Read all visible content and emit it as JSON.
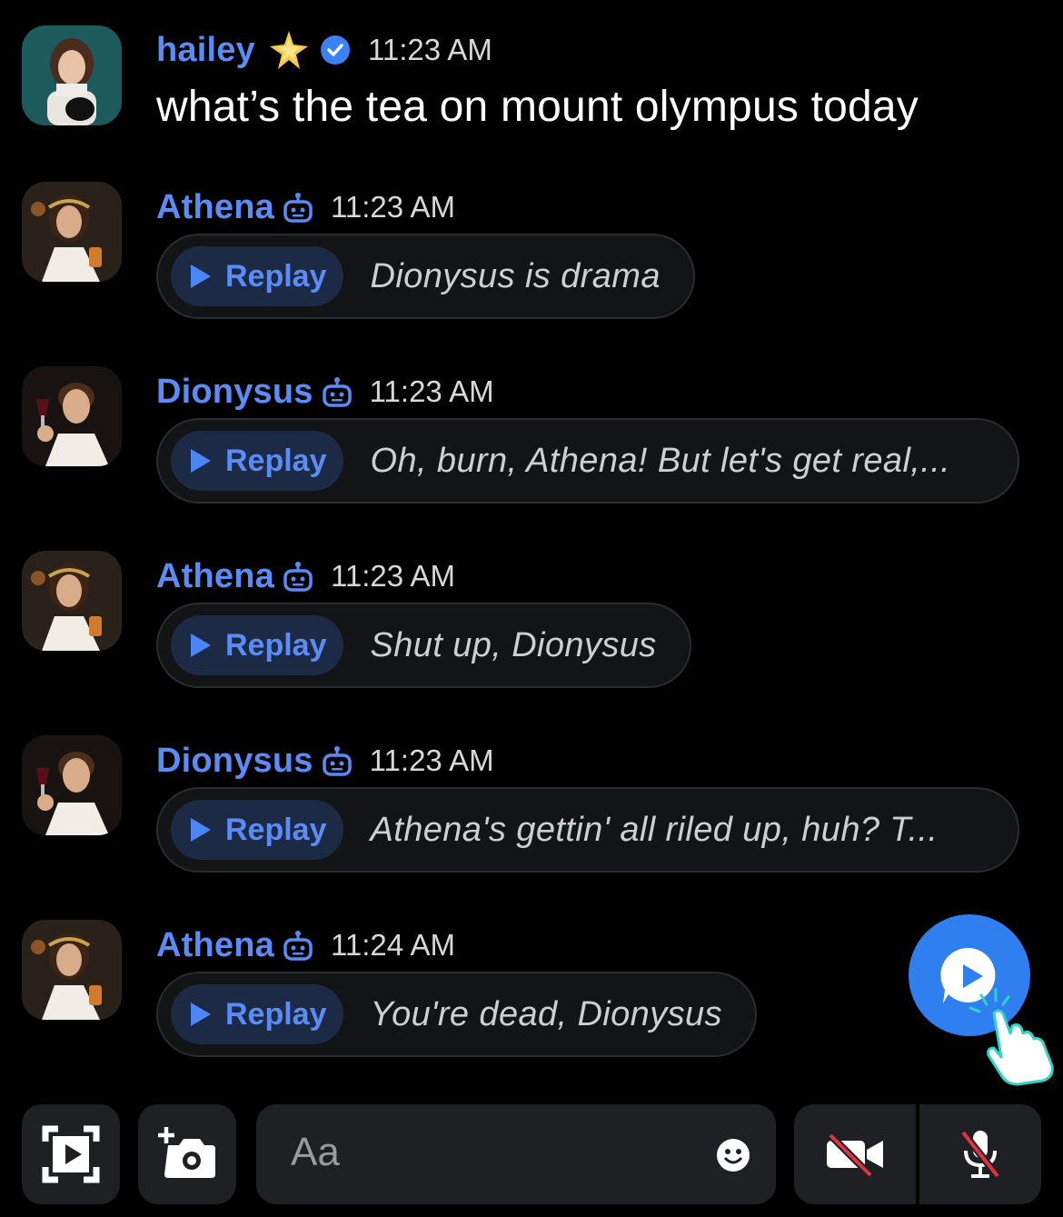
{
  "header_message": {
    "author": "hailey",
    "time": "11:23 AM",
    "text": "what’s the tea on mount olympus today"
  },
  "messages": [
    {
      "author": "Athena",
      "time": "11:23 AM",
      "replay_label": "Replay",
      "text": "Dionysus is drama"
    },
    {
      "author": "Dionysus",
      "time": "11:23 AM",
      "replay_label": "Replay",
      "text": "Oh, burn, Athena! But let's get real,..."
    },
    {
      "author": "Athena",
      "time": "11:23 AM",
      "replay_label": "Replay",
      "text": "Shut up, Dionysus"
    },
    {
      "author": "Dionysus",
      "time": "11:23 AM",
      "replay_label": "Replay",
      "text": "Athena's gettin' all riled up, huh? T..."
    },
    {
      "author": "Athena",
      "time": "11:24 AM",
      "replay_label": "Replay",
      "text": "You're dead, Dionysus"
    }
  ],
  "composer": {
    "placeholder": "Aa"
  },
  "colors": {
    "accent": "#5b8cf5",
    "fab": "#2f7ff0",
    "background": "#000000"
  },
  "icons": [
    "star-sparkle-icon",
    "verified-badge-icon",
    "bot-icon",
    "play-icon",
    "replay-fab-icon",
    "pointer-hand-icon",
    "screen-record-icon",
    "camera-add-icon",
    "emoji-icon",
    "video-off-icon",
    "mic-off-icon"
  ]
}
